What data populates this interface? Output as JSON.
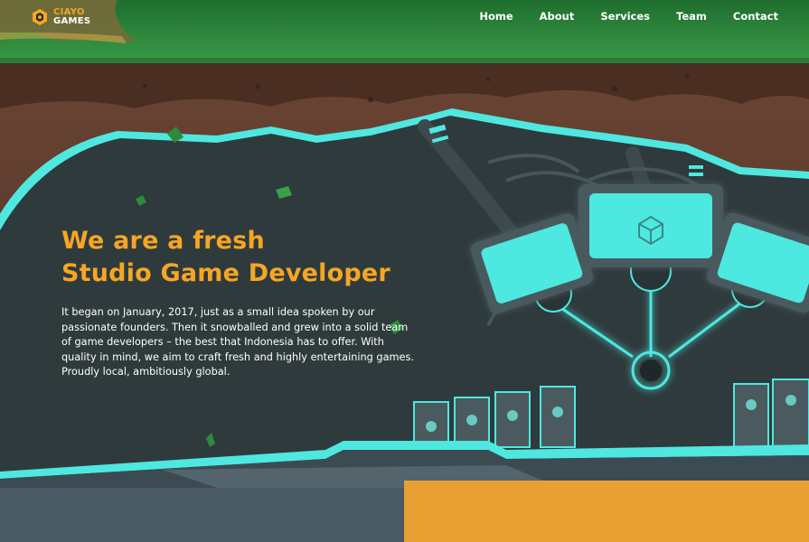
{
  "logo": {
    "top": "CIAYO",
    "bottom": "GAMES",
    "icon": "ciayo-logo-icon"
  },
  "nav": {
    "items": [
      {
        "label": "Home"
      },
      {
        "label": "About"
      },
      {
        "label": "Services"
      },
      {
        "label": "Team"
      },
      {
        "label": "Contact"
      }
    ]
  },
  "hero": {
    "title_line1": "We are a fresh",
    "title_line2": "Studio Game Developer",
    "body": "It began on January, 2017, just as a small idea spoken by our passionate founders. Then it snowballed and grew into a solid team of game developers – the best that Indonesia has to offer. With quality in mind, we aim to craft fresh and highly entertaining games. Proudly local, ambitiously global."
  },
  "colors": {
    "accent": "#f5a623",
    "cyan": "#4ee8e0",
    "cave": "#2f3a3d",
    "grass": "#2e8a3c"
  }
}
